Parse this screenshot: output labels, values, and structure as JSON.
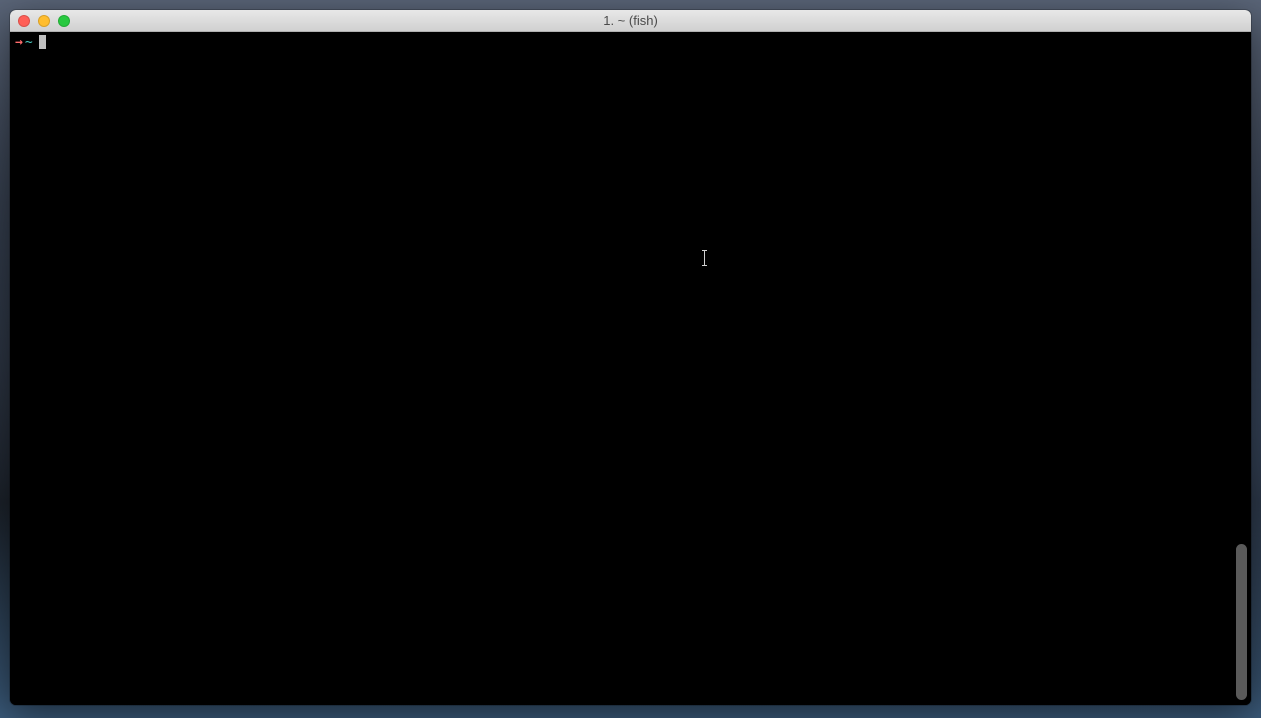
{
  "window": {
    "title": "1. ~ (fish)"
  },
  "terminal": {
    "prompt_arrow": "→",
    "prompt_cwd": "~",
    "input_value": ""
  },
  "colors": {
    "prompt_arrow": "#ff6b6b",
    "prompt_cwd": "#4ecdc4",
    "cursor": "#c0c0c0",
    "background": "#000000"
  }
}
